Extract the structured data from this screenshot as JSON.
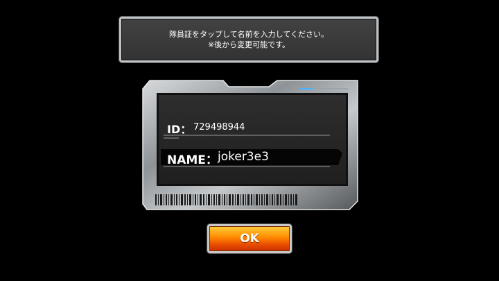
{
  "instruction": {
    "line1": "隊員証をタップして名前を入力してください。",
    "line2": "※後から変更可能です。"
  },
  "id_card": {
    "id_label": "ID：",
    "id_value": "729498944",
    "name_label": "NAME：",
    "name_value": "joker3e3"
  },
  "ok_button": {
    "label": "OK"
  },
  "colors": {
    "button_top": "#ffcf3a",
    "button_bottom": "#c93200",
    "frame_silver": "#c0c4c8",
    "accent_blue": "#4ab4ff"
  }
}
